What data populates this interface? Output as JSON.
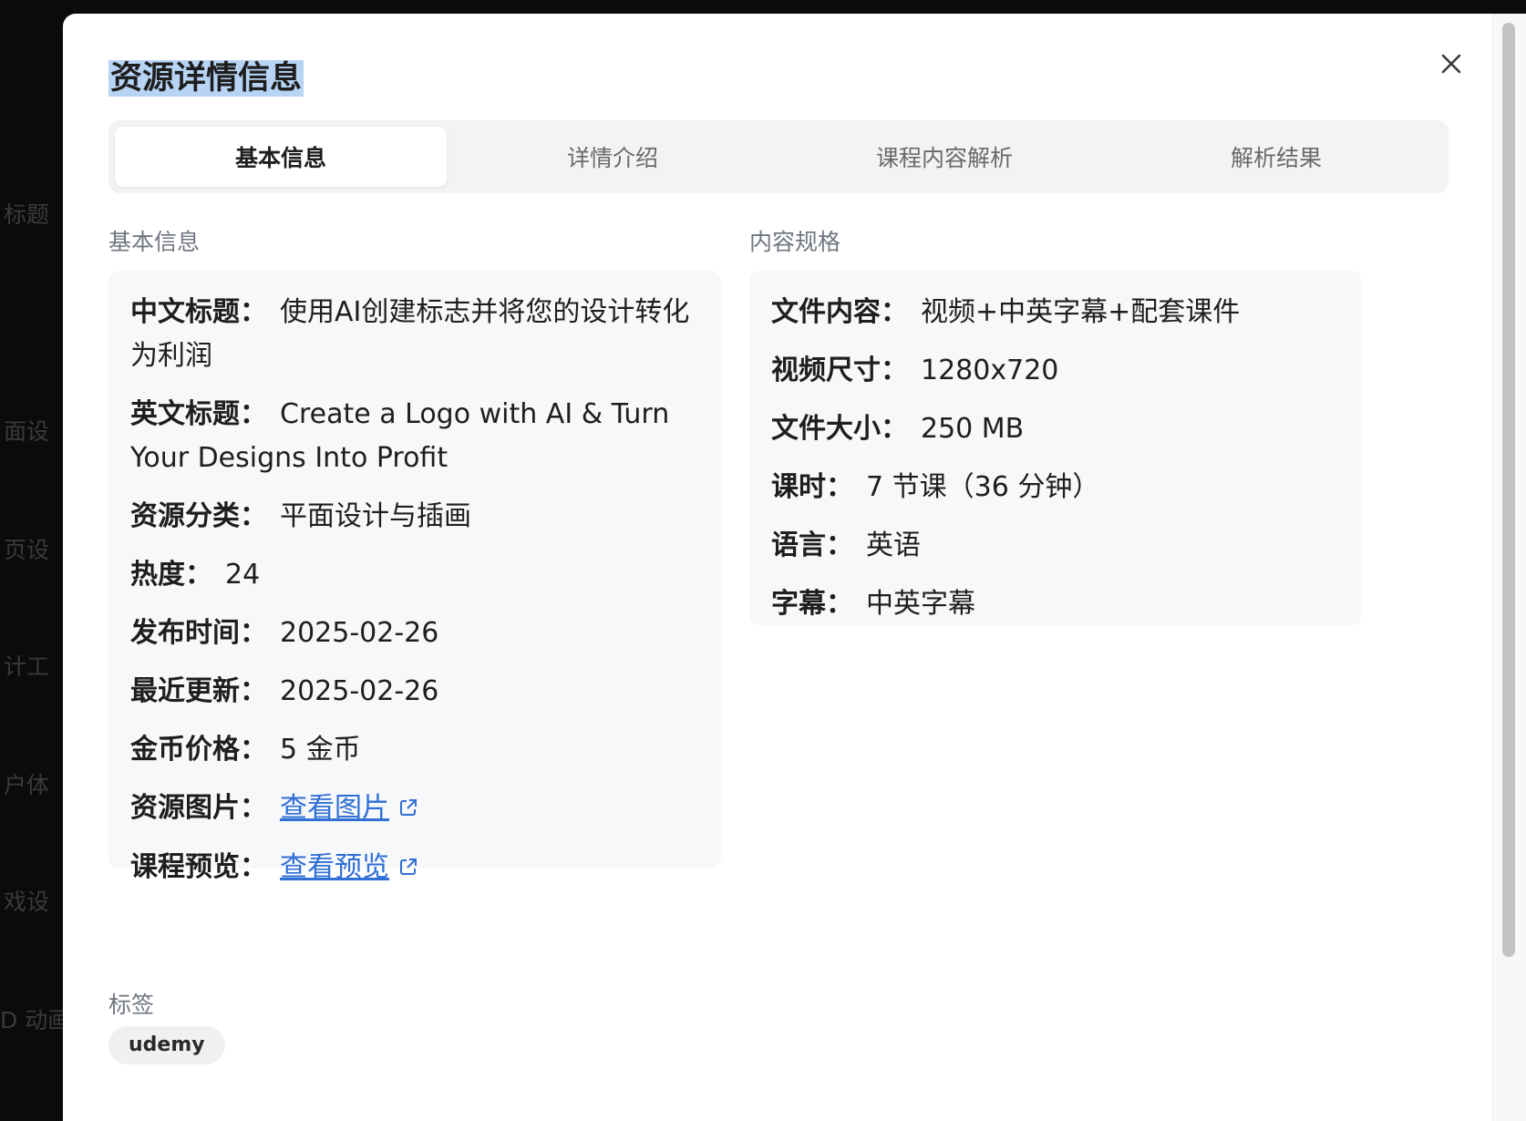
{
  "background_fragments": [
    "标题",
    "面设",
    "页设",
    "计工",
    "户体",
    "戏设",
    "D 动画"
  ],
  "modal": {
    "title": "资源详情信息",
    "close_icon": "close-icon"
  },
  "tabs": [
    {
      "label": "基本信息",
      "active": true
    },
    {
      "label": "详情介绍",
      "active": false
    },
    {
      "label": "课程内容解析",
      "active": false
    },
    {
      "label": "解析结果",
      "active": false
    }
  ],
  "basic_info": {
    "section_label": "基本信息",
    "rows": [
      {
        "key": "中文标题：",
        "value": "使用AI创建标志并将您的设计转化为利润"
      },
      {
        "key": "英文标题：",
        "value": "Create a Logo with AI & Turn Your Designs Into Profit"
      },
      {
        "key": "资源分类：",
        "value": "平面设计与插画"
      },
      {
        "key": "热度：",
        "value": "24"
      },
      {
        "key": "发布时间：",
        "value": "2025-02-26"
      },
      {
        "key": "最近更新：",
        "value": "2025-02-26"
      },
      {
        "key": "金币价格：",
        "value": "5 金币"
      },
      {
        "key": "资源图片：",
        "link_text": "查看图片",
        "icon": "external-link-icon"
      },
      {
        "key": "课程预览：",
        "link_text": "查看预览",
        "icon": "external-link-icon"
      }
    ]
  },
  "content_spec": {
    "section_label": "内容规格",
    "rows": [
      {
        "key": "文件内容：",
        "value": "视频+中英字幕+配套课件"
      },
      {
        "key": "视频尺寸：",
        "value": "1280x720"
      },
      {
        "key": "文件大小：",
        "value": "250 MB"
      },
      {
        "key": "课时：",
        "value": "7 节课（36 分钟）"
      },
      {
        "key": "语言：",
        "value": "英语"
      },
      {
        "key": "字幕：",
        "value": "中英字幕"
      }
    ]
  },
  "tags": {
    "section_label": "标签",
    "items": [
      "udemy"
    ]
  },
  "colors": {
    "link": "#2f6fd6",
    "selection": "#b7d4f5",
    "panel_bg": "#f7f8fa"
  }
}
